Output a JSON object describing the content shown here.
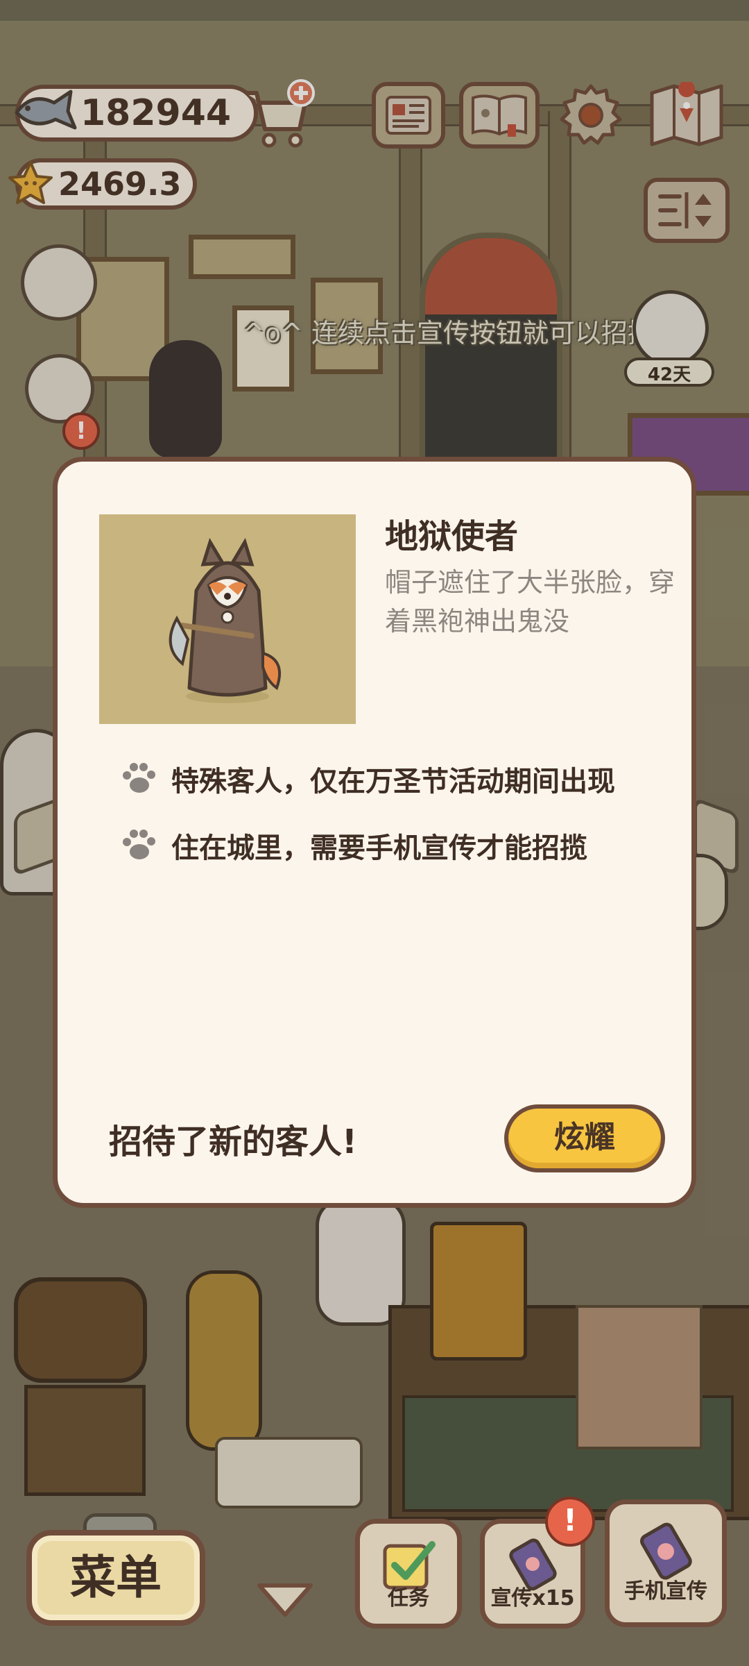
{
  "hud": {
    "fish_count": "182944",
    "star_count": "2469.3",
    "icons": {
      "fish": "fish-icon",
      "star": "star-icon",
      "cart": "cart-add-icon",
      "newspaper": "newspaper-icon",
      "book": "book-icon",
      "settings": "gear-icon",
      "map": "map-icon",
      "sort": "sort-icon"
    }
  },
  "ticker": {
    "text": "^o^ 连续点击宣传按钮就可以招揽更多"
  },
  "days_badge": "42天",
  "modal": {
    "guest_name": "地狱使者",
    "guest_description": "帽子遮住了大半张脸，穿着黑袍神出鬼没",
    "traits": [
      "特殊客人，仅在万圣节活动期间出现",
      "住在城里，需要手机宣传才能招揽"
    ],
    "footer_text": "招待了新的客人!",
    "show_off_button": "炫耀"
  },
  "bottom_bar": {
    "menu_label": "菜单",
    "task_label": "任务",
    "promote_label": "宣传x15",
    "phone_promote_label": "手机宣传",
    "alert_mark": "!"
  },
  "colors": {
    "border_brown": "#6f4c3b",
    "modal_bg": "#fcf5ec",
    "button_yellow": "#f7c540",
    "alert_red": "#e6654a"
  }
}
